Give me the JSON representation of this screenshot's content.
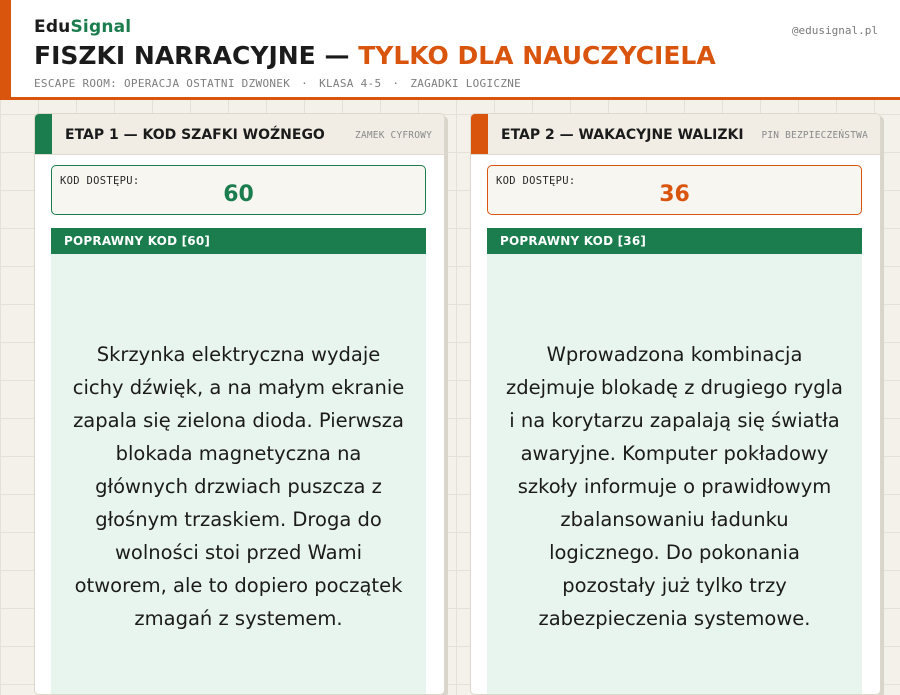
{
  "brand": {
    "part1": "Edu",
    "part2": "Signal"
  },
  "handle": "@edusignal.pl",
  "title": {
    "main": "FISZKI NARRACYJNE —",
    "accent": "TYLKO DLA NAUCZYCIELA"
  },
  "subtitle": {
    "room": "ESCAPE ROOM: OPERACJA OSTATNI DZWONEK",
    "separator": "·",
    "grade": "KLASA 4-5",
    "category": "ZAGADKI LOGICZNE"
  },
  "colors": {
    "green": "#1b7d4d",
    "orange": "#d9540d",
    "light_green": "#e8f5ee"
  },
  "cards": [
    {
      "title": "ETAP 1 — KOD SZAFKI WOŹNEGO",
      "tag": "ZAMEK CYFROWY",
      "code_label": "KOD DOSTĘPU:",
      "code_value": "60",
      "answer_label": "POPRAWNY KOD [60]",
      "text": "Skrzynka elektryczna wydaje cichy dźwięk, a na małym ekranie zapala się zielona dioda. Pierwsza blokada magnetyczna na głównych drzwiach puszcza z głośnym trzaskiem. Droga do wolności stoi przed Wami otworem, ale to dopiero początek zmagań z systemem."
    },
    {
      "title": "ETAP 2 — WAKACYJNE WALIZKI",
      "tag": "PIN BEZPIECZEŃSTWA",
      "code_label": "KOD DOSTĘPU:",
      "code_value": "36",
      "answer_label": "POPRAWNY KOD [36]",
      "text": "Wprowadzona kombinacja zdejmuje blokadę z drugiego rygla i na korytarzu zapalają się światła awaryjne. Komputer pokładowy szkoły informuje o prawidłowym zbalansowaniu ładunku logicznego. Do pokonania pozostały już tylko trzy zabezpieczenia systemowe."
    }
  ]
}
